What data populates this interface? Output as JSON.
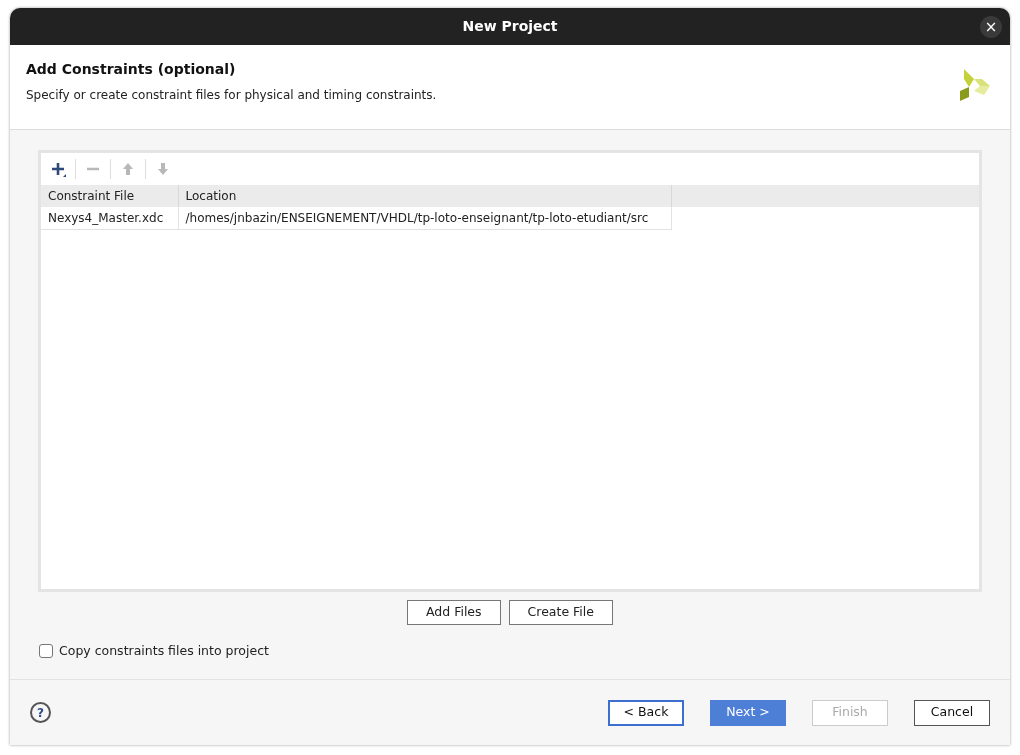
{
  "window": {
    "title": "New Project",
    "close": "×"
  },
  "header": {
    "title": "Add Constraints (optional)",
    "subtitle": "Specify or create constraint files for physical and timing constraints."
  },
  "toolbar": [
    {
      "kind": "add",
      "disabled": false
    },
    {
      "kind": "remove",
      "disabled": true
    },
    {
      "kind": "up",
      "disabled": true
    },
    {
      "kind": "down",
      "disabled": true
    }
  ],
  "table": {
    "columns": [
      "Constraint File",
      "Location"
    ],
    "rows": [
      [
        "Nexys4_Master.xdc",
        "/homes/jnbazin/ENSEIGNEMENT/VHDL/tp-loto-enseignant/tp-loto-etudiant/src"
      ]
    ]
  },
  "file_buttons": [
    "Add Files",
    "Create File"
  ],
  "copy_option": {
    "label": "Copy constraints files into project",
    "checked": false
  },
  "help": "?",
  "nav_buttons": [
    {
      "label": "< Back",
      "kind": "focused",
      "disabled": false
    },
    {
      "label": "Next >",
      "kind": "primary",
      "disabled": false
    },
    {
      "label": "Finish",
      "kind": "normal",
      "disabled": true
    },
    {
      "label": "Cancel",
      "kind": "normal",
      "disabled": false
    }
  ]
}
